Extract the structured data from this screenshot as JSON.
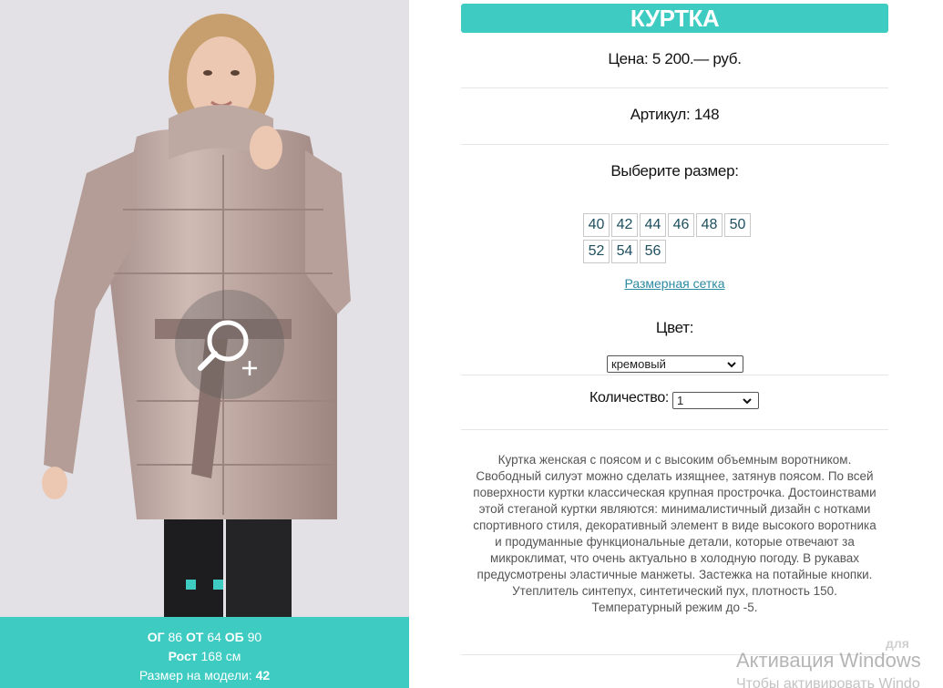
{
  "photo": {
    "zoom_icon": "zoom-in-icon",
    "slides": [
      "slide-1",
      "slide-2"
    ]
  },
  "measurements": {
    "og_label": "ОГ",
    "og_value": "86",
    "ot_label": "ОТ",
    "ot_value": "64",
    "ob_label": "ОБ",
    "ob_value": "90",
    "height_label": "Рост",
    "height_value": "168 см",
    "model_size_label": "Размер на модели:",
    "model_size_value": "42"
  },
  "product": {
    "title": "КУРТКА",
    "price": "Цена: 5 200.— руб.",
    "article": "Артикул: 148",
    "choose_size_label": "Выберите размер:",
    "sizes": [
      "40",
      "42",
      "44",
      "46",
      "48",
      "50",
      "52",
      "54",
      "56"
    ],
    "size_grid_link": "Размерная сетка",
    "color_label": "Цвет:",
    "color_selected": "кремовый",
    "quantity_label": "Количество:",
    "quantity_selected": "1",
    "description": "Куртка женская с поясом и с высоким объемным воротником. Свободный силуэт можно сделать изящнее, затянув поясом. По всей поверхности куртки классическая крупная прострочка. Достоинствами этой стеганой куртки являются: минималистичный дизайн с нотками спортивного стиля, декоративный элемент в виде высокого воротника и продуманные функциональные детали, которые отвечают за микроклимат, что очень актуально в холодную погоду. В рукавах предусмотрены эластичные манжеты. Застежка на потайные кнопки. Утеплитель синтепух, синтетический пух, плотность 150. Температурный режим до -5."
  },
  "watermark": {
    "title": "Активация Windows",
    "subtitle": "Чтобы активировать Windo",
    "small": "для"
  },
  "colors": {
    "accent": "#3ecbc2",
    "link": "#2d8aa3",
    "size_text": "#1d4f5f"
  }
}
